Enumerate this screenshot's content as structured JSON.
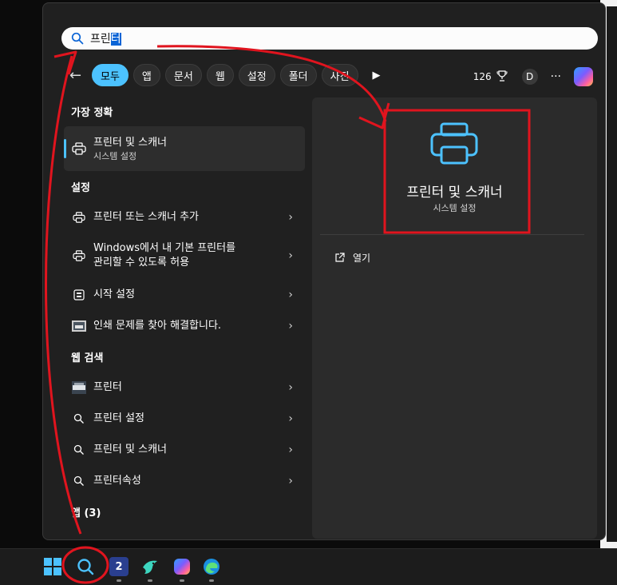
{
  "search": {
    "typed": "프린",
    "selected": "터"
  },
  "filters": {
    "back_icon": "arrow-left-icon",
    "chips": [
      "모두",
      "앱",
      "문서",
      "웹",
      "설정",
      "폴더",
      "사진"
    ],
    "active_index": 0,
    "more_icon": "play-icon"
  },
  "tray": {
    "points": "126",
    "avatar": "D",
    "more": "···"
  },
  "best_match": {
    "heading": "가장 정확",
    "title": "프린터 및 스캐너",
    "subtitle": "시스템 설정"
  },
  "settings_section": {
    "heading": "설정",
    "items": [
      {
        "label": "프린터 또는 스캐너 추가",
        "icon": "printer-icon"
      },
      {
        "line1": "Windows에서 내 기본 프린터를",
        "line2": "관리할 수 있도록 허용",
        "icon": "printer-icon"
      },
      {
        "label": "시작 설정",
        "icon": "start-icon"
      },
      {
        "label": "인쇄 문제를 찾아 해결합니다.",
        "icon": "troubleshoot-icon"
      }
    ]
  },
  "web_section": {
    "heading": "웹 검색",
    "items": [
      {
        "label": "프린터",
        "icon": "printer-thumbnail"
      },
      {
        "label": "프린터 설정",
        "icon": "search-icon"
      },
      {
        "label": "프린터 및 스캐너",
        "icon": "search-icon"
      },
      {
        "label": "프린터속성",
        "icon": "search-icon"
      }
    ]
  },
  "apps_section": {
    "heading": "앱 (3)"
  },
  "detail": {
    "title": "프린터 및 스캐너",
    "subtitle": "시스템 설정",
    "open_label": "열기"
  },
  "taskbar": {
    "items": [
      "windows-start-icon",
      "search-icon",
      "app-2-icon",
      "bird-app-icon",
      "copilot-icon",
      "edge-icon"
    ],
    "badge": "2"
  },
  "colors": {
    "accent": "#4cc2ff",
    "annotation": "#e0141e",
    "panel": "#202020"
  }
}
